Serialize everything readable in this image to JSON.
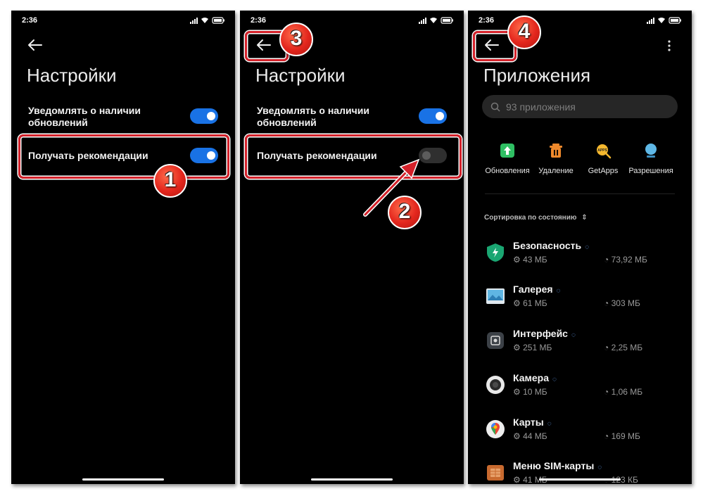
{
  "status_time": "2:36",
  "panel1": {
    "title": "Настройки",
    "row1_label": "Уведомлять о наличии обновлений",
    "row2_label": "Получать рекомендации",
    "badge": "1"
  },
  "panel2": {
    "title": "Настройки",
    "row1_label": "Уведомлять о наличии обновлений",
    "row2_label": "Получать рекомендации",
    "badge_toggle": "2",
    "badge_back": "3"
  },
  "panel3": {
    "title": "Приложения",
    "search_placeholder": "93 приложения",
    "badge_back": "4",
    "quick_actions": [
      {
        "label": "Обновления",
        "icon": "update-icon"
      },
      {
        "label": "Удаление",
        "icon": "trash-icon"
      },
      {
        "label": "GetApps",
        "icon": "getapps-icon"
      },
      {
        "label": "Разрешения",
        "icon": "permissions-icon"
      }
    ],
    "sort_label": "Сортировка по состоянию",
    "apps": [
      {
        "name": "Безопасность",
        "app_size": "43 МБ",
        "data_size": "73,92 МБ",
        "icon": "security-icon"
      },
      {
        "name": "Галерея",
        "app_size": "61 МБ",
        "data_size": "303 МБ",
        "icon": "gallery-icon"
      },
      {
        "name": "Интерфейс",
        "app_size": "251 МБ",
        "data_size": "2,25 МБ",
        "icon": "interface-icon"
      },
      {
        "name": "Камера",
        "app_size": "10 МБ",
        "data_size": "1,06 МБ",
        "icon": "camera-icon"
      },
      {
        "name": "Карты",
        "app_size": "44 МБ",
        "data_size": "169 МБ",
        "icon": "maps-icon"
      },
      {
        "name": "Меню SIM-карты",
        "app_size": "41 МБ",
        "data_size": "123 КБ",
        "icon": "sim-menu-icon"
      }
    ]
  },
  "colors": {
    "toggle_on": "#1972e5",
    "highlight": "#d4212a",
    "badge": "#e3261d"
  }
}
